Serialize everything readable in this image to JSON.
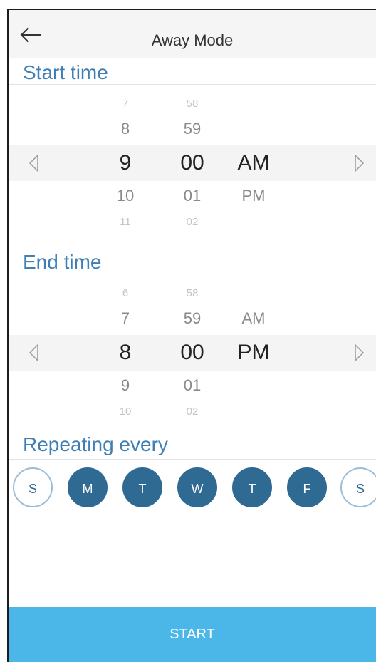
{
  "header": {
    "title": "Away Mode",
    "back_icon": "arrow-left-icon"
  },
  "start_time": {
    "title": "Start time",
    "hours": {
      "far_above": "7",
      "above": "8",
      "selected": "9",
      "below": "10",
      "far_below": "11"
    },
    "minutes": {
      "far_above": "58",
      "above": "59",
      "selected": "00",
      "below": "01",
      "far_below": "02"
    },
    "period": {
      "selected": "AM",
      "below": "PM"
    }
  },
  "end_time": {
    "title": "End time",
    "hours": {
      "far_above": "6",
      "above": "7",
      "selected": "8",
      "below": "9",
      "far_below": "10"
    },
    "minutes": {
      "far_above": "58",
      "above": "59",
      "selected": "00",
      "below": "01",
      "far_below": "02"
    },
    "period": {
      "above": "AM",
      "selected": "PM"
    }
  },
  "repeat": {
    "title": "Repeating every",
    "days": [
      {
        "label": "S",
        "selected": false
      },
      {
        "label": "M",
        "selected": true
      },
      {
        "label": "T",
        "selected": true
      },
      {
        "label": "W",
        "selected": true
      },
      {
        "label": "T",
        "selected": true
      },
      {
        "label": "F",
        "selected": true
      },
      {
        "label": "S",
        "selected": false
      }
    ]
  },
  "start_button": {
    "label": "START"
  },
  "colors": {
    "accent": "#3f7fb5",
    "day_selected": "#2f6a93",
    "start_button": "#4bb6e8"
  }
}
